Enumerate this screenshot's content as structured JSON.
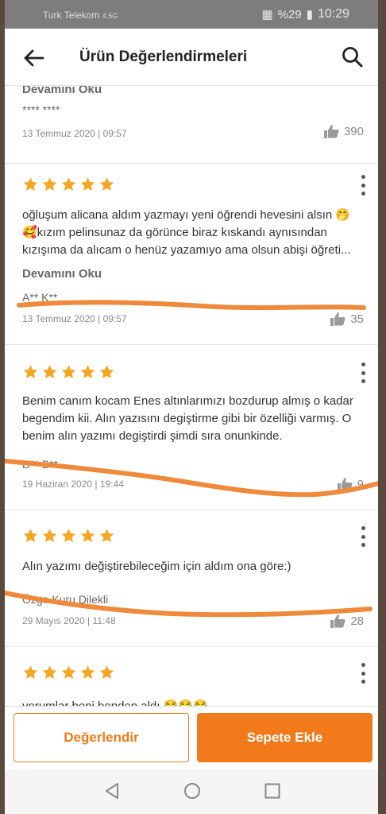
{
  "status": {
    "carrier": "Turk Telekom",
    "signal": "4.5G",
    "battery": "%29",
    "time": "10:29"
  },
  "header": {
    "title": "Ürün Değerlendirmeleri"
  },
  "reviews": [
    {
      "more_label": "Devamını Oku",
      "author": "**** ****",
      "date": "13 Temmuz 2020 | 09:57",
      "likes": "390"
    },
    {
      "text": "oğluşum alicana aldım yazmayı yeni öğrendi hevesini alsın 🤭🥰kızım pelinsunaz da görünce biraz kıskandı aynısından kızışıma da alıcam o henüz yazamıyo ama olsun abişi öğreti...",
      "more_label": "Devamını Oku",
      "author": "A** K**",
      "date": "13 Temmuz 2020 | 09:57",
      "likes": "35"
    },
    {
      "text": "Benim canım kocam Enes altınlarımızı bozdurup almış o kadar begendim kii. Alın yazısını degiştirme gibi bir özelliği varmış. O benim alın yazımı degiştirdi şimdi sıra onunkinde.",
      "author": "D** B**",
      "date": "19 Haziran 2020 | 19:44",
      "likes": "9"
    },
    {
      "text": "Alın yazımı değiştirebileceğim için aldım ona göre:)",
      "author": "Özge Kuru Dilekli",
      "date": "29 Mayıs 2020 | 11:48",
      "likes": "28"
    },
    {
      "text": "yorumlar beni benden aldı 😂😂😂"
    }
  ],
  "actions": {
    "review_label": "Değerlendir",
    "cart_label": "Sepete Ekle"
  },
  "colors": {
    "accent": "#f27a1a",
    "star": "#f5a623",
    "scribble": "#ef8a3c"
  }
}
